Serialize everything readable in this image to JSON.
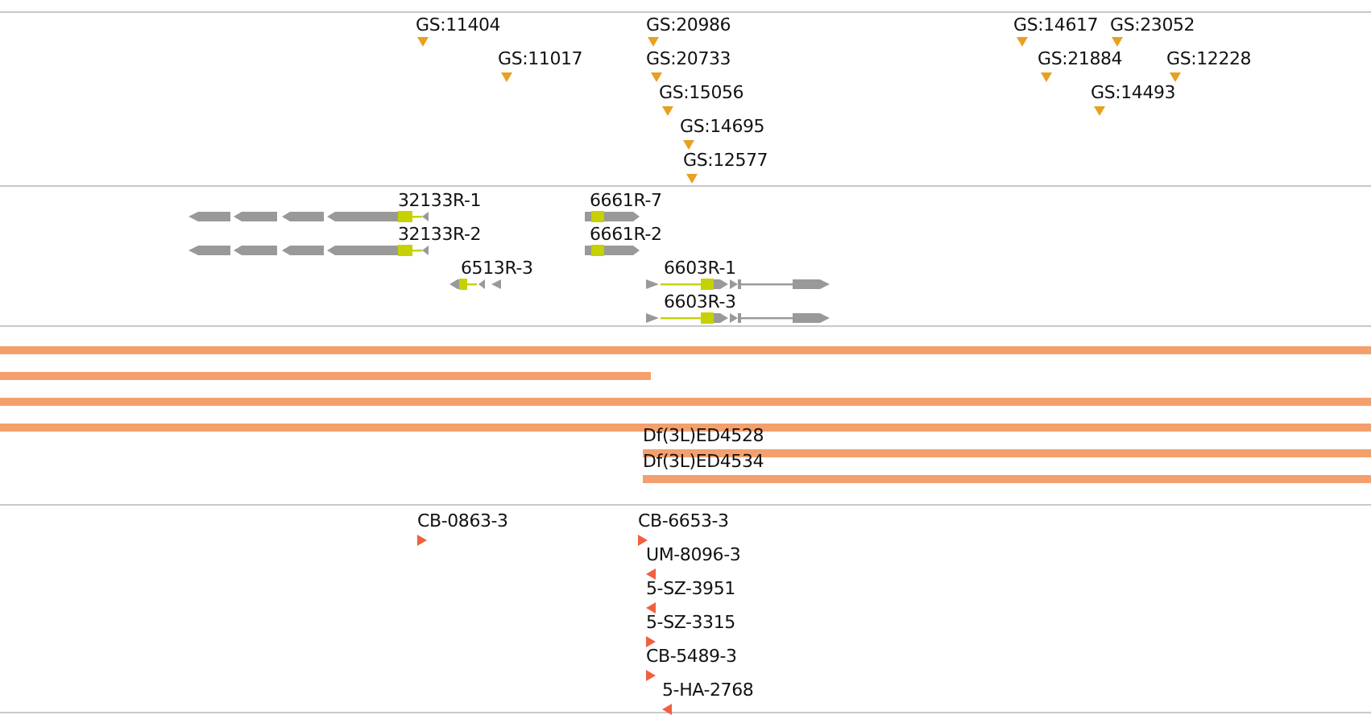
{
  "insertion_track": {
    "items": [
      {
        "label": "GS:11404"
      },
      {
        "label": "GS:11017"
      },
      {
        "label": "GS:20986"
      },
      {
        "label": "GS:20733"
      },
      {
        "label": "GS:15056"
      },
      {
        "label": "GS:14695"
      },
      {
        "label": "GS:12577"
      },
      {
        "label": "GS:14617"
      },
      {
        "label": "GS:23052"
      },
      {
        "label": "GS:21884"
      },
      {
        "label": "GS:12228"
      },
      {
        "label": "GS:14493"
      }
    ]
  },
  "transcript_track": {
    "items": [
      {
        "label": "32133R-1"
      },
      {
        "label": "32133R-2"
      },
      {
        "label": "6513R-3"
      },
      {
        "label": "6661R-7"
      },
      {
        "label": "6661R-2"
      },
      {
        "label": "6603R-1"
      },
      {
        "label": "6603R-3"
      }
    ]
  },
  "deletion_track": {
    "items": [
      {
        "kind": "unlabeled"
      },
      {
        "kind": "unlabeled"
      },
      {
        "kind": "unlabeled"
      },
      {
        "kind": "unlabeled"
      },
      {
        "kind": "labeled",
        "label": "Df(3L)ED4528"
      },
      {
        "kind": "labeled",
        "label": "Df(3L)ED4534"
      }
    ]
  },
  "element_track": {
    "items": [
      {
        "label": "CB-0863-3",
        "reverse": false
      },
      {
        "label": "CB-6653-3",
        "reverse": false
      },
      {
        "label": "UM-8096-3",
        "reverse": true
      },
      {
        "label": "5-SZ-3951",
        "reverse": true
      },
      {
        "label": "5-SZ-3315",
        "reverse": false
      },
      {
        "label": "CB-5489-3",
        "reverse": false
      },
      {
        "label": "5-HA-2768",
        "reverse": true
      }
    ]
  }
}
